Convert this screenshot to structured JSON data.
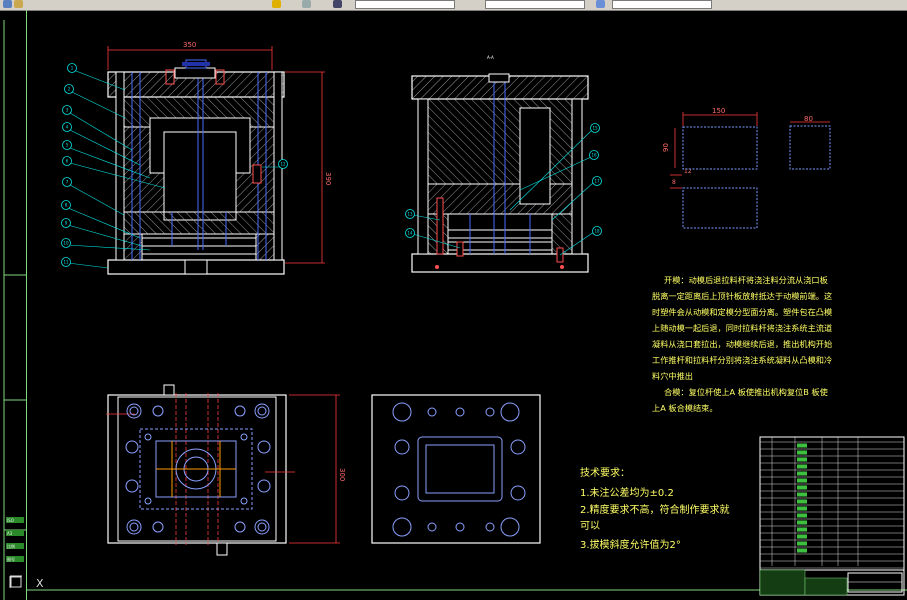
{
  "toolbar": {
    "dims_value": "350",
    "top_label": "—"
  },
  "cad": {
    "dimensions": {
      "top_width": "350",
      "right_height": "390",
      "rect_a_width": "150",
      "rect_a_height": "90",
      "rect_b_width": "80",
      "gap_a": "12",
      "gap_b": "8",
      "plan_height": "300"
    },
    "balloons": [
      "1",
      "2",
      "3",
      "4",
      "5",
      "6",
      "7",
      "8",
      "9",
      "10",
      "11",
      "12",
      "13",
      "14",
      "15",
      "16",
      "17",
      "18",
      "19",
      "20",
      "21",
      "22",
      "23",
      "24"
    ],
    "notes_lines": [
      "开模：动模后退拉料杆将浇注料分流从浇口板",
      "脱离一定距离后上顶针板放射抵达于动模前端。这",
      "时塑件会从动模和定模分型面分离。塑件包在凸模",
      "上随动模一起后退，同时拉料杆将浇注系统主流道",
      "凝料从浇口套拉出，动模继续后退，推出机构开始",
      "工作推杆和拉料杆分别将浇注系统凝料从凸模和冷",
      "料穴中推出",
      "合模：复位杆使上A 板使推出机构复位B 板使",
      "上A 板合模结束。"
    ],
    "tech_req": {
      "title": "技术要求：",
      "items": [
        "1.未注公差均为±0.2",
        "2.精度要求不高，符合制作要求就",
        "可以",
        "3.拔模斜度允许值为2°"
      ]
    },
    "left_panel_labels": [
      "ISO",
      "A3",
      "比例",
      "图号"
    ]
  },
  "colors": {
    "background": "#000000",
    "outline": "#ffffff",
    "dimension": "#ff3b3b",
    "hatch": "#c8c8c8",
    "hidden": "#4a6cff",
    "leader": "#00e5e5",
    "note_text": "#ffff66",
    "frame": "#7fd97f"
  }
}
